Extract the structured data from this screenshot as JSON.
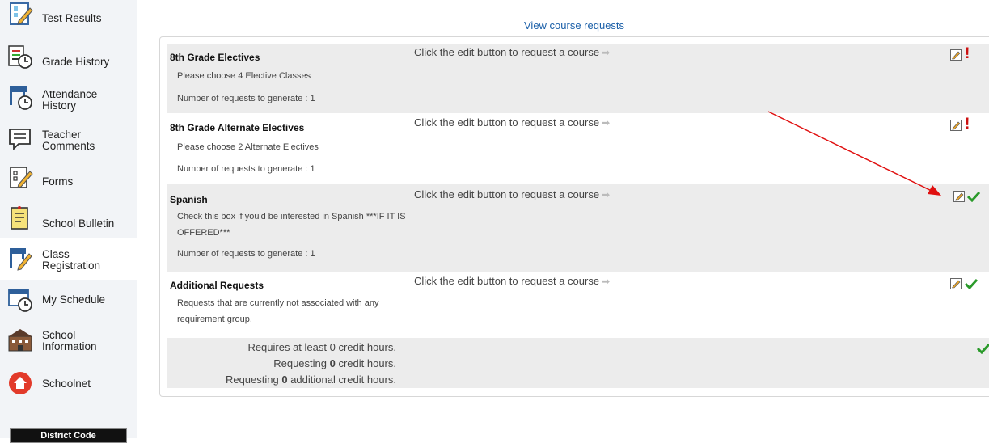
{
  "sidebar": {
    "items": [
      {
        "label": "Test Results",
        "icon": "test-results-icon"
      },
      {
        "label": "Grade History",
        "icon": "grade-history-icon"
      },
      {
        "label": "Attendance\nHistory",
        "icon": "attendance-icon"
      },
      {
        "label": "Teacher\nComments",
        "icon": "comments-icon"
      },
      {
        "label": "Forms",
        "icon": "forms-icon"
      },
      {
        "label": "School Bulletin",
        "icon": "bulletin-icon"
      },
      {
        "label": "Class\nRegistration",
        "icon": "registration-icon"
      },
      {
        "label": "My Schedule",
        "icon": "schedule-icon"
      },
      {
        "label": "School\nInformation",
        "icon": "school-icon"
      },
      {
        "label": "Schoolnet",
        "icon": "home-icon"
      }
    ],
    "district_code_label": "District Code"
  },
  "main": {
    "view_link": "View course requests",
    "edit_prompt": "Click the edit button to request a course",
    "groups": [
      {
        "title": "8th Grade Electives",
        "description": "Please choose 4 Elective Classes",
        "count": "Number of requests to generate : 1",
        "status": "incomplete"
      },
      {
        "title": "8th Grade Alternate Electives",
        "description": "Please choose 2 Alternate Electives",
        "count": "Number of requests to generate : 1",
        "status": "incomplete"
      },
      {
        "title": "Spanish",
        "description": "Check this box if you'd be interested in Spanish ***IF IT IS OFFERED***",
        "count": "Number of requests to generate : 1",
        "status": "complete"
      },
      {
        "title": "Additional Requests",
        "description": "Requests that are currently not associated with any requirement group.",
        "count": "",
        "status": "complete"
      }
    ],
    "summary": {
      "requires_prefix": "Requires at least ",
      "requires_value": "0",
      "requires_suffix": " credit hours.",
      "requesting_prefix": "Requesting ",
      "requesting_value": "0",
      "requesting_suffix": " credit hours.",
      "additional_prefix": "Requesting ",
      "additional_value": "0",
      "additional_suffix": " additional credit hours.",
      "status": "complete"
    }
  },
  "colors": {
    "link": "#1a5fa8",
    "check": "#2a9a2a",
    "error": "#cc1010",
    "annotation_arrow": "#e01010"
  }
}
